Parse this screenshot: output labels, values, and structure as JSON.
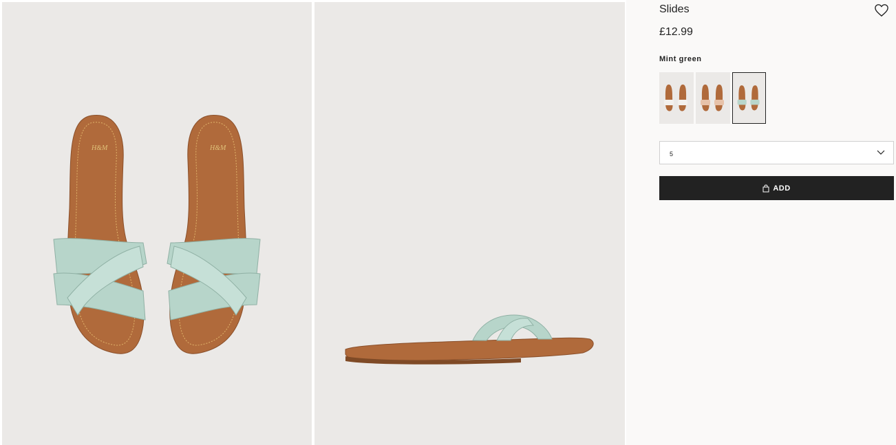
{
  "product": {
    "title": "Slides",
    "price": "£12.99",
    "favorite_icon": "heart-outline-icon"
  },
  "color": {
    "selected_name": "Mint green",
    "swatches": [
      {
        "strap_color": "#f3f1ee",
        "selected": false
      },
      {
        "strap_color": "#e7c2a9",
        "selected": false
      },
      {
        "strap_color": "#b9d6cb",
        "selected": true
      }
    ]
  },
  "size_select": {
    "value": "5",
    "icon": "chevron-down-icon"
  },
  "add_button": {
    "label": "ADD",
    "icon": "bag-icon"
  },
  "colors": {
    "sole": "#b06a3b",
    "strap": "#b7d5ca",
    "photo_bg": "#ebe9e7",
    "button_bg": "#222222"
  }
}
